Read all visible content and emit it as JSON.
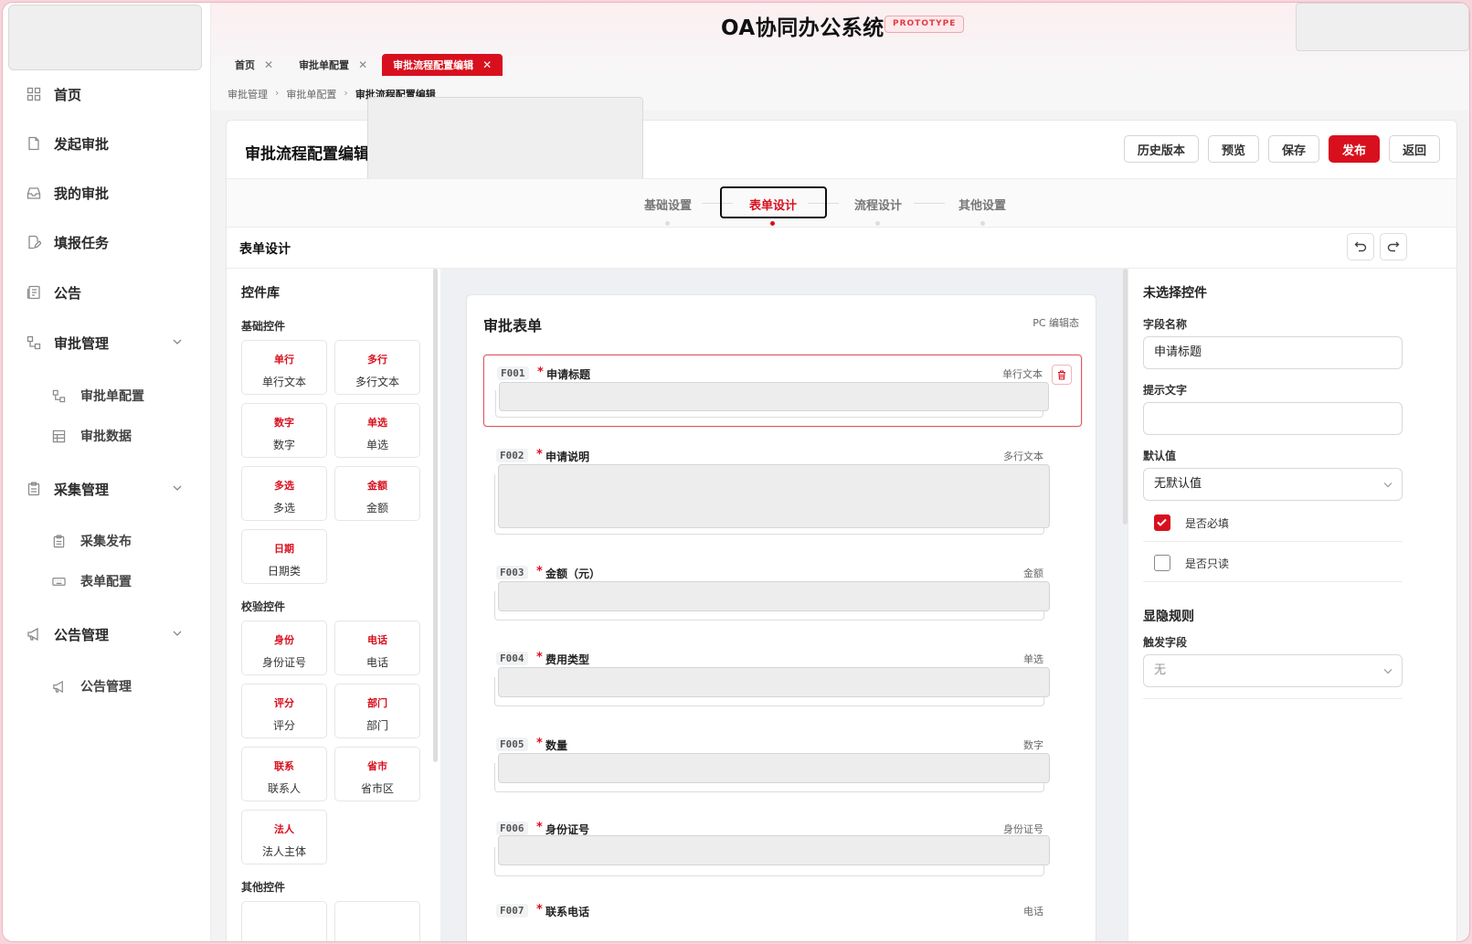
{
  "app": {
    "title": "OA协同办公系统",
    "badge": "PROTOTYPE"
  },
  "sidebar": {
    "items": [
      {
        "label": "首页",
        "icon": "grid-icon"
      },
      {
        "label": "发起审批",
        "icon": "document-icon"
      },
      {
        "label": "我的审批",
        "icon": "inbox-icon"
      },
      {
        "label": "填报任务",
        "icon": "edit-doc-icon"
      },
      {
        "label": "公告",
        "icon": "notice-icon"
      },
      {
        "label": "审批管理",
        "icon": "flow-icon",
        "expanded": true,
        "children": [
          {
            "label": "审批单配置",
            "icon": "flow-icon"
          },
          {
            "label": "审批数据",
            "icon": "table-icon"
          }
        ]
      },
      {
        "label": "采集管理",
        "icon": "clipboard-icon",
        "expanded": true,
        "children": [
          {
            "label": "采集发布",
            "icon": "clipboard-icon"
          },
          {
            "label": "表单配置",
            "icon": "keyboard-icon"
          }
        ]
      },
      {
        "label": "公告管理",
        "icon": "megaphone-icon",
        "expanded": true,
        "children": [
          {
            "label": "公告管理",
            "icon": "megaphone-icon"
          }
        ]
      }
    ]
  },
  "tabs": [
    {
      "label": "首页",
      "active": false
    },
    {
      "label": "审批单配置",
      "active": false
    },
    {
      "label": "审批流程配置编辑",
      "active": true
    }
  ],
  "breadcrumb": [
    "审批管理",
    "审批单配置",
    "审批流程配置编辑"
  ],
  "page": {
    "title": "审批流程配置编辑",
    "actions": {
      "history": "历史版本",
      "preview": "预览",
      "save": "保存",
      "publish": "发布",
      "back": "返回"
    },
    "steps": [
      "基础设置",
      "表单设计",
      "流程设计",
      "其他设置"
    ],
    "active_step": 1,
    "section_title": "表单设计"
  },
  "library": {
    "title": "控件库",
    "groups": [
      {
        "title": "基础控件",
        "items": [
          {
            "tag": "单行",
            "name": "单行文本"
          },
          {
            "tag": "多行",
            "name": "多行文本"
          },
          {
            "tag": "数字",
            "name": "数字"
          },
          {
            "tag": "单选",
            "name": "单选"
          },
          {
            "tag": "多选",
            "name": "多选"
          },
          {
            "tag": "金额",
            "name": "金额"
          },
          {
            "tag": "日期",
            "name": "日期类"
          }
        ]
      },
      {
        "title": "校验控件",
        "items": [
          {
            "tag": "身份",
            "name": "身份证号"
          },
          {
            "tag": "电话",
            "name": "电话"
          },
          {
            "tag": "评分",
            "name": "评分"
          },
          {
            "tag": "部门",
            "name": "部门"
          },
          {
            "tag": "联系",
            "name": "联系人"
          },
          {
            "tag": "省市",
            "name": "省市区"
          },
          {
            "tag": "法人",
            "name": "法人主体"
          }
        ]
      },
      {
        "title": "其他控件",
        "items": []
      }
    ]
  },
  "form": {
    "title": "审批表单",
    "mode": "PC 编辑态",
    "fields": [
      {
        "code": "F001",
        "label": "申请标题",
        "type": "单行文本",
        "required": true,
        "selected": true
      },
      {
        "code": "F002",
        "label": "申请说明",
        "type": "多行文本",
        "required": true
      },
      {
        "code": "F003",
        "label": "金额（元）",
        "type": "金额",
        "required": true
      },
      {
        "code": "F004",
        "label": "费用类型",
        "type": "单选",
        "required": true
      },
      {
        "code": "F005",
        "label": "数量",
        "type": "数字",
        "required": true
      },
      {
        "code": "F006",
        "label": "身份证号",
        "type": "身份证号",
        "required": true
      },
      {
        "code": "F007",
        "label": "联系电话",
        "type": "电话",
        "required": true
      }
    ]
  },
  "props": {
    "title": "未选择控件",
    "field_name_label": "字段名称",
    "field_name_value": "申请标题",
    "hint_label": "提示文字",
    "hint_value": "",
    "default_label": "默认值",
    "default_value": "无默认值",
    "required_label": "是否必填",
    "required": true,
    "readonly_label": "是否只读",
    "readonly": false,
    "visibility_title": "显隐规则",
    "trigger_label": "触发字段",
    "trigger_value": "无"
  }
}
